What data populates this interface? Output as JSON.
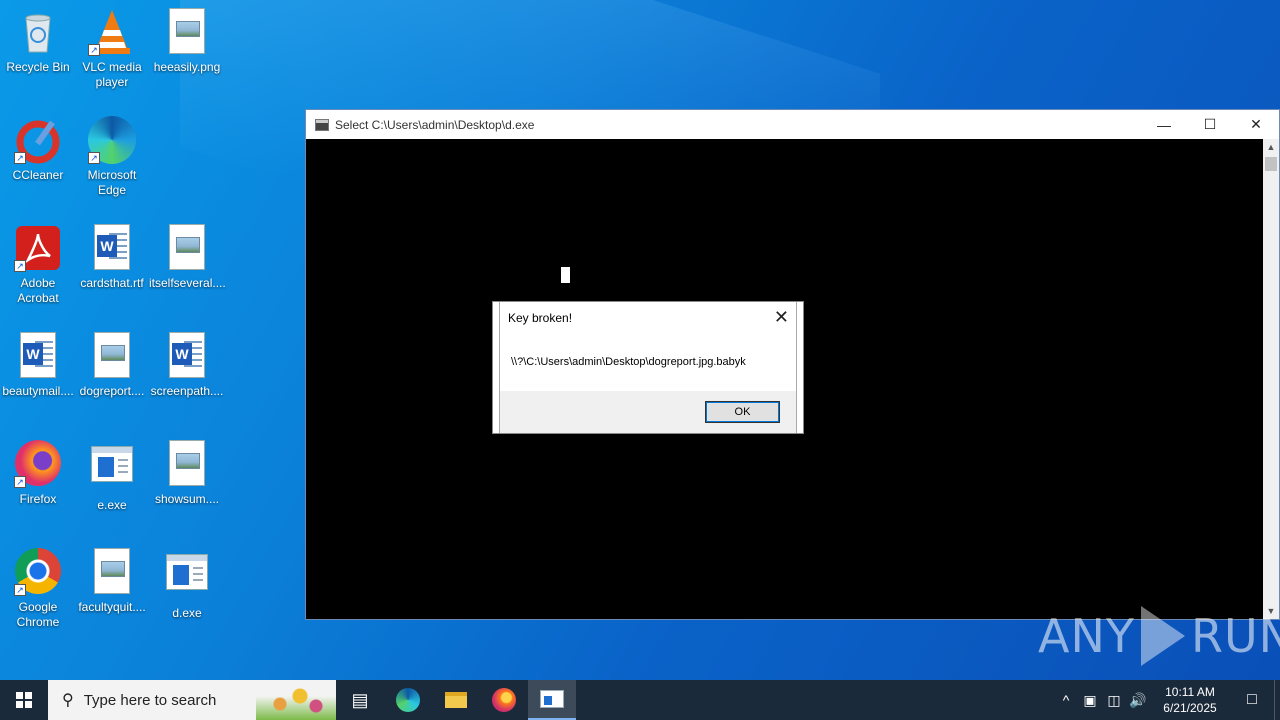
{
  "desktop": {
    "icons": [
      {
        "label": "Recycle Bin",
        "icon": "recycle-bin-icon"
      },
      {
        "label": "VLC media player",
        "icon": "vlc-icon"
      },
      {
        "label": "heeasily.png",
        "icon": "image-file-icon"
      },
      {
        "label": "CCleaner",
        "icon": "ccleaner-icon"
      },
      {
        "label": "Microsoft Edge",
        "icon": "edge-icon"
      },
      {
        "label": "Adobe Acrobat",
        "icon": "acrobat-icon"
      },
      {
        "label": "cardsthat.rtf",
        "icon": "word-doc-icon"
      },
      {
        "label": "itselfseveral....",
        "icon": "image-file-icon"
      },
      {
        "label": "beautymail....",
        "icon": "word-doc-icon"
      },
      {
        "label": "dogreport....",
        "icon": "image-file-icon"
      },
      {
        "label": "screenpath....",
        "icon": "word-doc-icon"
      },
      {
        "label": "Firefox",
        "icon": "firefox-icon"
      },
      {
        "label": "e.exe",
        "icon": "exe-icon"
      },
      {
        "label": "showsum....",
        "icon": "image-file-icon"
      },
      {
        "label": "Google Chrome",
        "icon": "chrome-icon"
      },
      {
        "label": "facultyquit....",
        "icon": "image-file-icon"
      },
      {
        "label": "d.exe",
        "icon": "exe-icon"
      }
    ]
  },
  "console_window": {
    "title": "Select C:\\Users\\admin\\Desktop\\d.exe",
    "minimize": "—",
    "maximize": "☐",
    "close": "✕"
  },
  "message_box": {
    "title": "Key broken!",
    "close": "✕",
    "text": "\\\\?\\C:\\Users\\admin\\Desktop\\dogreport.jpg.babyk",
    "ok_label": "OK"
  },
  "watermark": {
    "left": "ANY",
    "right": "RUN"
  },
  "taskbar": {
    "search_placeholder": "Type here to search",
    "tray_chevron": "^",
    "time": "10:11 AM",
    "date": "6/21/2025"
  }
}
